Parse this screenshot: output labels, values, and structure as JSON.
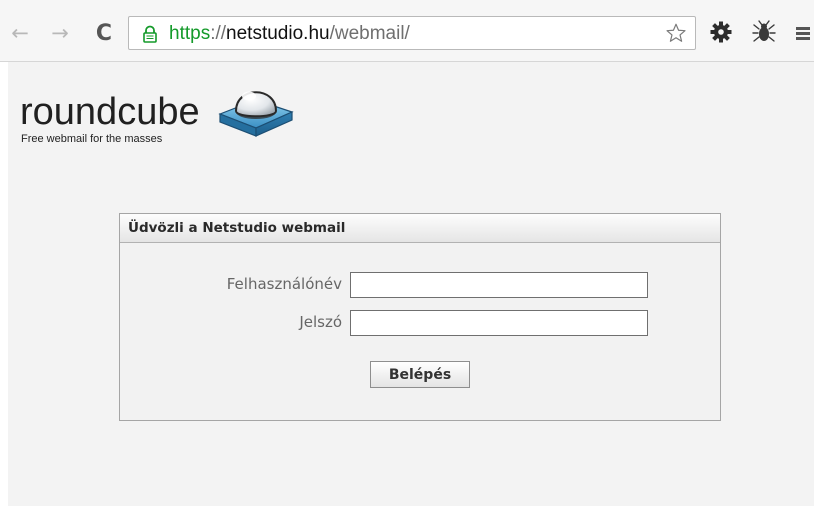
{
  "browser": {
    "url": {
      "scheme": "https",
      "separator": "://",
      "host": "netstudio.hu",
      "path": "/webmail/"
    },
    "icons": {
      "back": "back-arrow-icon",
      "forward": "forward-arrow-icon",
      "reload": "reload-icon",
      "lock": "lock-icon",
      "bookmark": "star-icon",
      "extension_1": "gear-icon",
      "extension_2": "bug-icon",
      "menu": "hamburger-menu-icon"
    },
    "colors": {
      "secure_scheme": "#149a2a"
    }
  },
  "logo": {
    "wordmark": "roundcube",
    "tagline": "Free webmail for the masses"
  },
  "login": {
    "title": "Üdvözli a Netstudio webmail",
    "username_label": "Felhasználónév",
    "username_value": "",
    "password_label": "Jelszó",
    "password_value": "",
    "submit_label": "Belépés"
  }
}
